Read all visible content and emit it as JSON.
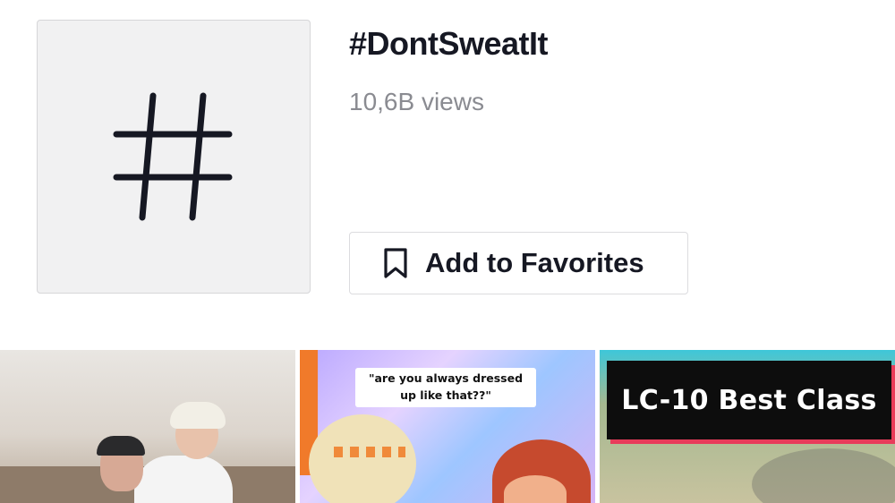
{
  "hashtag": {
    "title": "#DontSweatIt",
    "views": "10,6B views",
    "icon": "hashtag-icon"
  },
  "favorites_button": {
    "label": "Add to Favorites",
    "icon": "bookmark-icon"
  },
  "videos": [
    {
      "caption": ""
    },
    {
      "caption": "\"are you always dressed up like that??\""
    },
    {
      "caption": "LC-10 Best Class"
    }
  ],
  "colors": {
    "text_primary": "#161823",
    "text_secondary": "#8a8b91",
    "thumb_bg": "#f1f1f2",
    "banner_accent": "#e83b5a"
  }
}
